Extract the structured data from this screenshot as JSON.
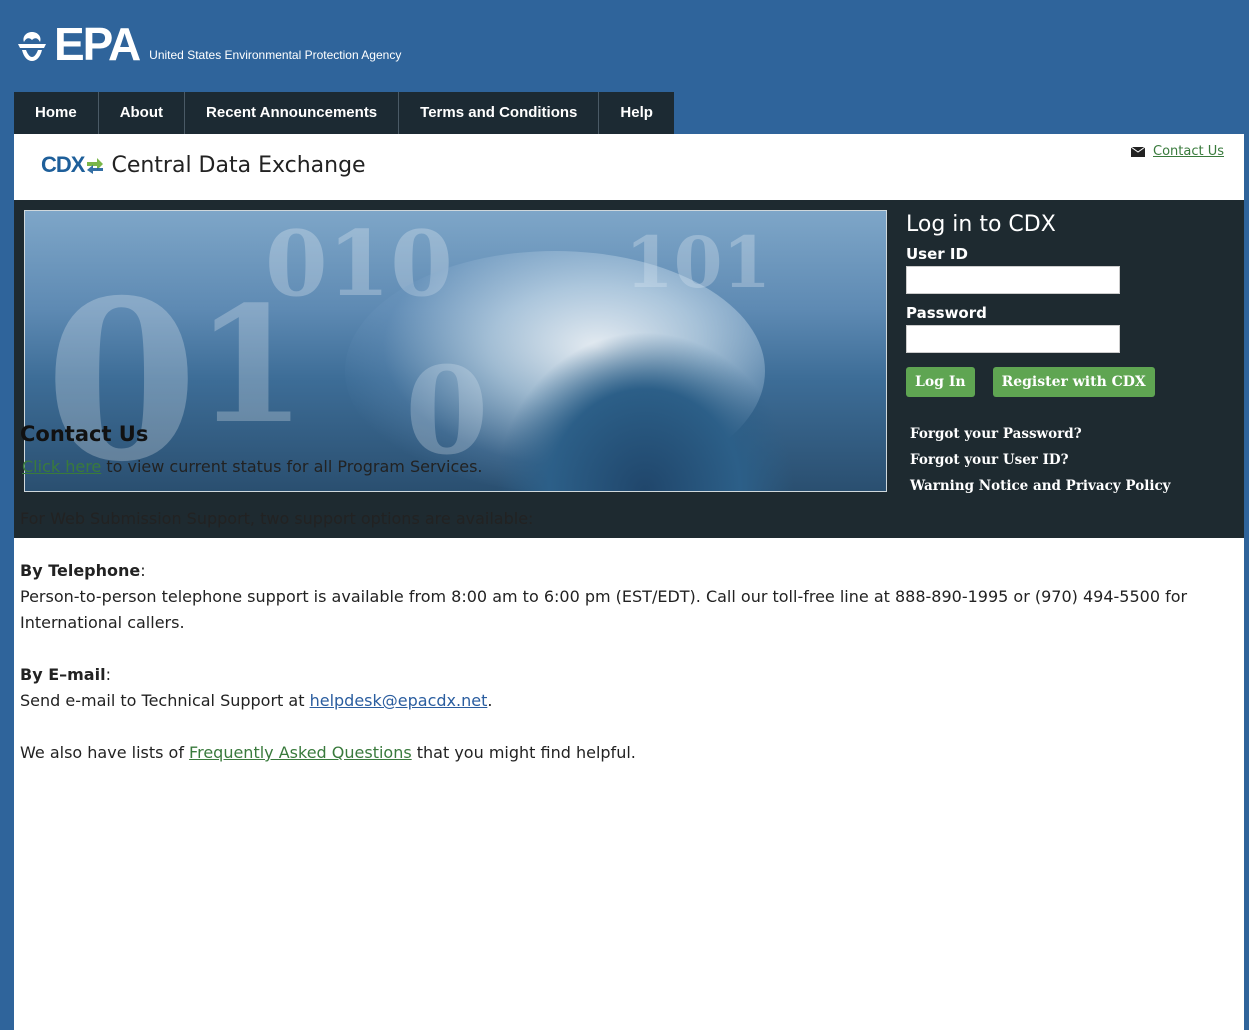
{
  "header": {
    "brand": "EPA",
    "agency": "United States Environmental Protection Agency"
  },
  "nav": [
    "Home",
    "About",
    "Recent Announcements",
    "Terms and Conditions",
    "Help"
  ],
  "site": {
    "logo_text": "CDX",
    "title": "Central Data Exchange",
    "contact_link": "Contact Us"
  },
  "login": {
    "title": "Log in to CDX",
    "user_id_label": "User ID",
    "user_id_value": "",
    "password_label": "Password",
    "password_value": "",
    "login_button": "Log In",
    "register_button": "Register with CDX",
    "links": [
      "Forgot your Password?",
      "Forgot your User ID?",
      "Warning Notice and Privacy Policy"
    ]
  },
  "content": {
    "heading": "Contact Us",
    "status_link": "Click here",
    "status_text": " to view current status for all Program Services.",
    "intro": "For Web Submission Support, two support options are available:",
    "telephone_heading": "By Telephone",
    "telephone_text": "Person-to-person telephone support is available from 8:00 am to 6:00 pm (EST/EDT). Call our toll-free line at 888-890-1995 or (970) 494-5500 for International callers.",
    "email_heading": "By E–mail",
    "email_text_before": "Send e-mail to Technical Support at ",
    "email_link": "helpdesk@epacdx.net",
    "email_text_after": ".",
    "faq_before": "We also have lists of ",
    "faq_link": "Frequently Asked Questions",
    "faq_after": " that you might find helpful."
  },
  "colors": {
    "header_blue": "#2f649b",
    "nav_dark": "#1c2a33",
    "hero_dark": "#1e2a30",
    "button_green": "#5fa552",
    "link_green": "#397a3c",
    "link_blue": "#2a5d9f",
    "cdx_blue": "#1e5f9a"
  },
  "icons": [
    "epa-flower-icon",
    "cdx-arrow-icon",
    "envelope-icon"
  ]
}
